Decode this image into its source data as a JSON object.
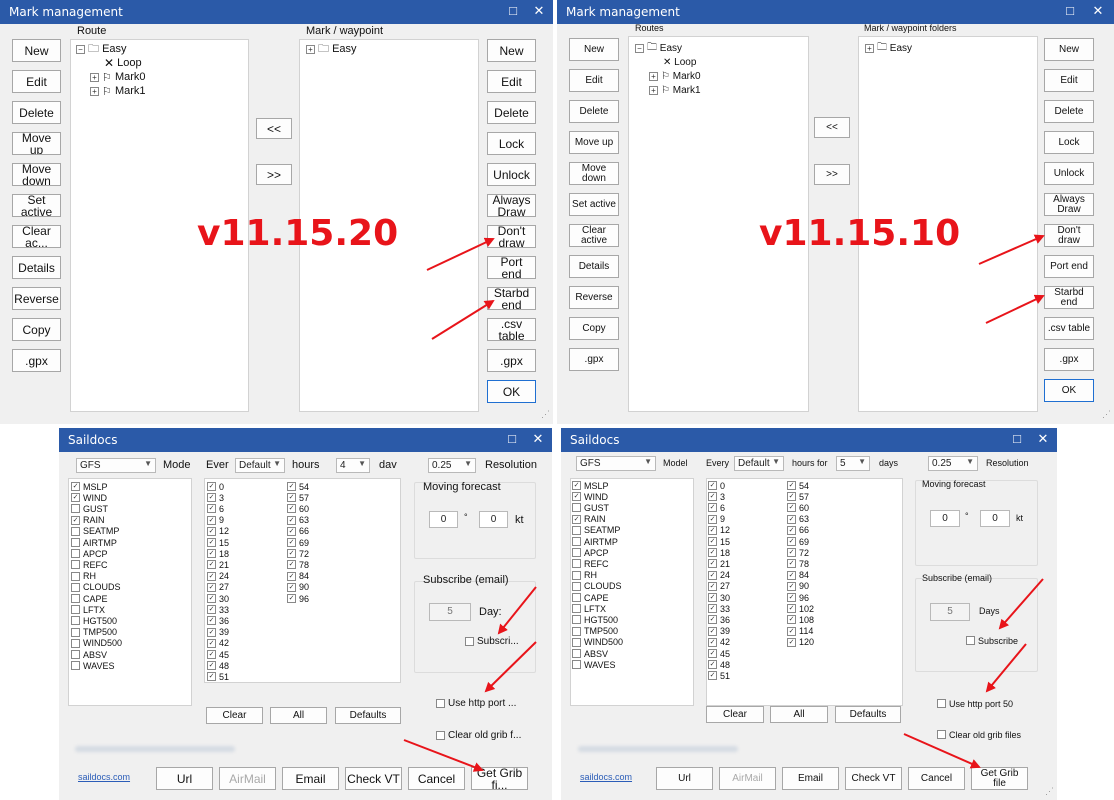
{
  "colors": {
    "titlebar": "#2b5aa8",
    "accent": "#e8141a",
    "link": "#2b5db8"
  },
  "mm_left": {
    "title": "Mark management",
    "route_label": "Route",
    "mark_label": "Mark / waypoint",
    "left_buttons": [
      "New",
      "Edit",
      "Delete",
      "Move up",
      "Move down",
      "Set active",
      "Clear ac...",
      "Details",
      "Reverse",
      "Copy",
      ".gpx"
    ],
    "right_buttons": [
      "New",
      "Edit",
      "Delete",
      "Lock",
      "Unlock",
      "Always Draw",
      "Don't draw",
      "Port end",
      "Starbd end",
      ".csv table",
      ".gpx",
      "OK"
    ],
    "tree_left": [
      "Easy",
      "Loop",
      "Mark0",
      "Mark1"
    ],
    "tree_right": [
      "Easy"
    ],
    "move_left": "<<",
    "move_right": ">>",
    "version": "v11.15.20"
  },
  "mm_right": {
    "title": "Mark management",
    "route_label": "Routes",
    "mark_label": "Mark / waypoint folders",
    "left_buttons": [
      "New",
      "Edit",
      "Delete",
      "Move up",
      "Move down",
      "Set active",
      "Clear active",
      "Details",
      "Reverse",
      "Copy",
      ".gpx"
    ],
    "right_buttons": [
      "New",
      "Edit",
      "Delete",
      "Lock",
      "Unlock",
      "Always Draw",
      "Don't draw",
      "Port end",
      "Starbd end",
      ".csv table",
      ".gpx",
      "OK"
    ],
    "tree_left": [
      "Easy",
      "Loop",
      "Mark0",
      "Mark1"
    ],
    "tree_right": [
      "Easy"
    ],
    "move_left": "<<",
    "move_right": ">>",
    "version": "v11.15.10"
  },
  "sd_left": {
    "title": "Saildocs",
    "model": "GFS",
    "mode_label": "Mode",
    "every_label": "Ever",
    "every_value": "Default",
    "hours_label": "hours",
    "days_value": "4",
    "days_label": "dav",
    "res_value": "0.25",
    "res_label": "Resolution",
    "params": [
      {
        "n": "MSLP",
        "c": true
      },
      {
        "n": "WIND",
        "c": true
      },
      {
        "n": "GUST",
        "c": false
      },
      {
        "n": "RAIN",
        "c": true
      },
      {
        "n": "SEATMP",
        "c": false
      },
      {
        "n": "AIRTMP",
        "c": false
      },
      {
        "n": "APCP",
        "c": false
      },
      {
        "n": "REFC",
        "c": false
      },
      {
        "n": "RH",
        "c": false
      },
      {
        "n": "CLOUDS",
        "c": false
      },
      {
        "n": "CAPE",
        "c": false
      },
      {
        "n": "LFTX",
        "c": false
      },
      {
        "n": "HGT500",
        "c": false
      },
      {
        "n": "TMP500",
        "c": false
      },
      {
        "n": "WIND500",
        "c": false
      },
      {
        "n": "ABSV",
        "c": false
      },
      {
        "n": "WAVES",
        "c": false
      }
    ],
    "hours_col1": [
      "0",
      "3",
      "6",
      "9",
      "12",
      "15",
      "18",
      "21",
      "24",
      "27",
      "30",
      "33",
      "36",
      "39",
      "42",
      "45",
      "48",
      "51"
    ],
    "hours_col2": [
      "54",
      "57",
      "60",
      "63",
      "66",
      "69",
      "72",
      "78",
      "84",
      "90",
      "96"
    ],
    "moving_label": "Moving forecast",
    "mv1": "0",
    "deg": "°",
    "mv2": "0",
    "kt": "kt",
    "subscribe_label": "Subscribe (email)",
    "sub_days": "5",
    "days_word": "Day:",
    "subscribe_chk": "Subscri...",
    "http_port": "Use http port ...",
    "clear_old": "Clear old grib f...",
    "btn_clear": "Clear",
    "btn_all": "All",
    "btn_defaults": "Defaults",
    "link": "saildocs.com",
    "bottom": [
      "Url",
      "AirMail",
      "Email",
      "Check VT",
      "Cancel",
      "Get Grib fi..."
    ]
  },
  "sd_right": {
    "title": "Saildocs",
    "model": "GFS",
    "mode_label": "Model",
    "every_label": "Every",
    "every_value": "Default",
    "hours_label": "hours for",
    "days_value": "5",
    "days_label": "days",
    "res_value": "0.25",
    "res_label": "Resolution",
    "params": [
      {
        "n": "MSLP",
        "c": true
      },
      {
        "n": "WIND",
        "c": true
      },
      {
        "n": "GUST",
        "c": false
      },
      {
        "n": "RAIN",
        "c": true
      },
      {
        "n": "SEATMP",
        "c": false
      },
      {
        "n": "AIRTMP",
        "c": false
      },
      {
        "n": "APCP",
        "c": false
      },
      {
        "n": "REFC",
        "c": false
      },
      {
        "n": "RH",
        "c": false
      },
      {
        "n": "CLOUDS",
        "c": false
      },
      {
        "n": "CAPE",
        "c": false
      },
      {
        "n": "LFTX",
        "c": false
      },
      {
        "n": "HGT500",
        "c": false
      },
      {
        "n": "TMP500",
        "c": false
      },
      {
        "n": "WIND500",
        "c": false
      },
      {
        "n": "ABSV",
        "c": false
      },
      {
        "n": "WAVES",
        "c": false
      }
    ],
    "hours_col1": [
      "0",
      "3",
      "6",
      "9",
      "12",
      "15",
      "18",
      "21",
      "24",
      "27",
      "30",
      "33",
      "36",
      "39",
      "42",
      "45",
      "48",
      "51"
    ],
    "hours_col2": [
      "54",
      "57",
      "60",
      "63",
      "66",
      "69",
      "72",
      "78",
      "84",
      "90",
      "96",
      "102",
      "108",
      "114",
      "120"
    ],
    "moving_label": "Moving forecast",
    "mv1": "0",
    "deg": "°",
    "mv2": "0",
    "kt": "kt",
    "subscribe_label": "Subscribe (email)",
    "sub_days": "5",
    "days_word": "Days",
    "subscribe_chk": "Subscribe",
    "http_port": "Use http port 50",
    "clear_old": "Clear old grib files",
    "btn_clear": "Clear",
    "btn_all": "All",
    "btn_defaults": "Defaults",
    "link": "saildocs.com",
    "bottom": [
      "Url",
      "AirMail",
      "Email",
      "Check VT",
      "Cancel",
      "Get Grib file"
    ]
  },
  "icons": {
    "maximize": "maximize-icon",
    "close": "close-icon",
    "folder": "folder-icon",
    "flag": "flag-icon",
    "cross": "route-x-icon"
  }
}
